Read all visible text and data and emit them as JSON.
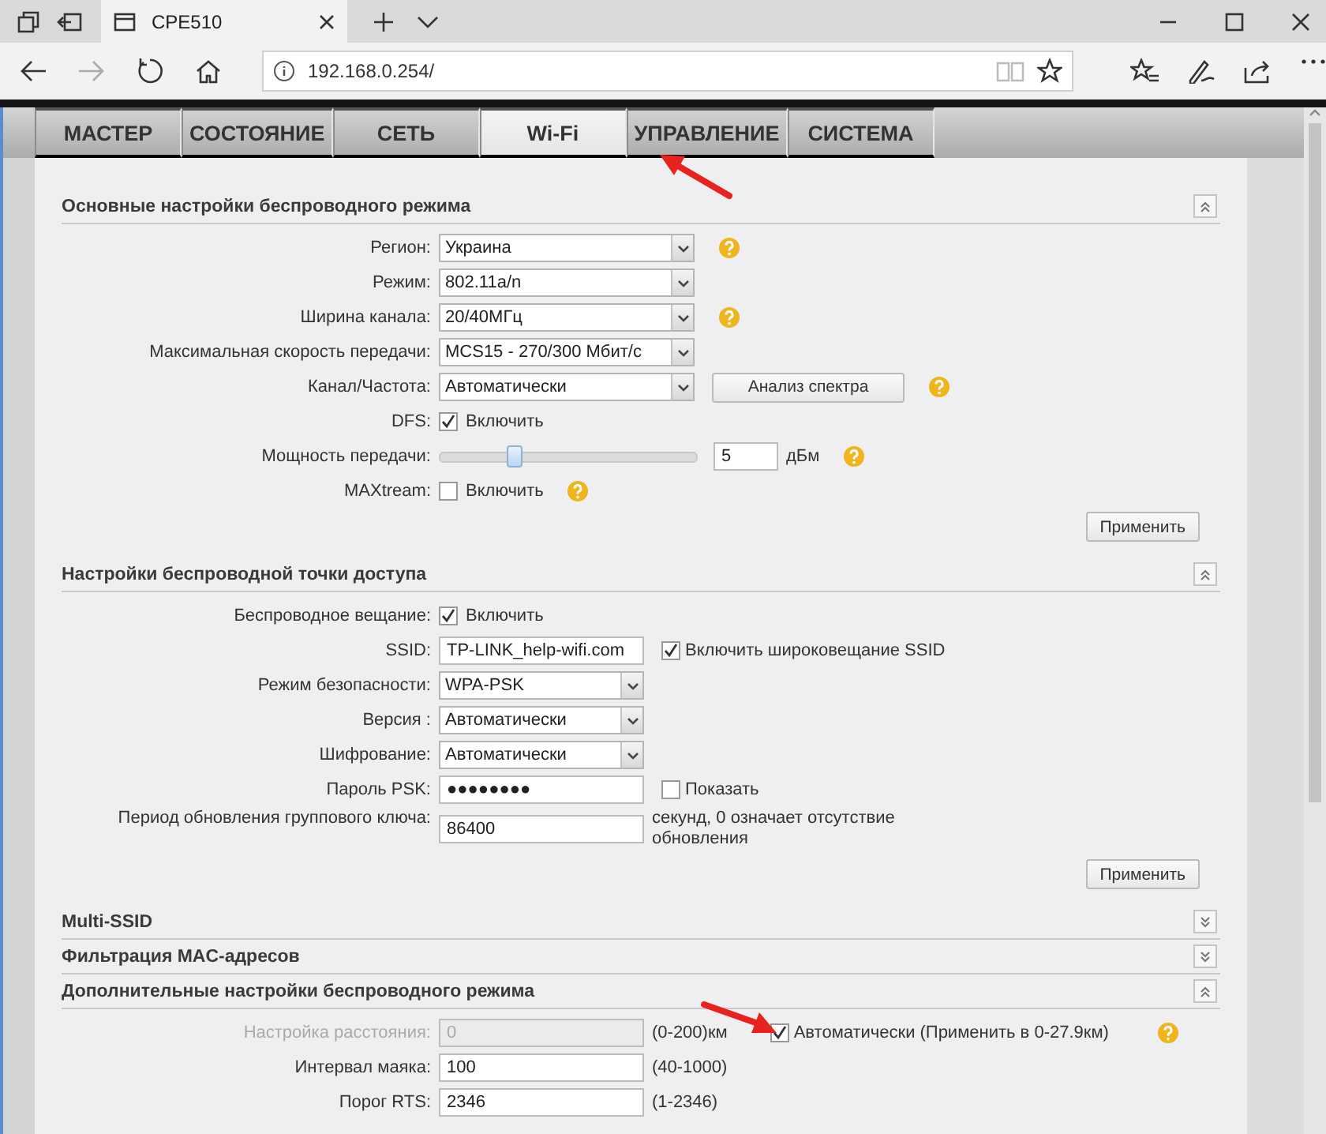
{
  "browser": {
    "tab_title": "CPE510",
    "url": "192.168.0.254/"
  },
  "nav_tabs": [
    {
      "label": "МАСТЕР",
      "selected": false
    },
    {
      "label": "СОСТОЯНИЕ",
      "selected": false
    },
    {
      "label": "СЕТЬ",
      "selected": false
    },
    {
      "label": "Wi-Fi",
      "selected": true
    },
    {
      "label": "УПРАВЛЕНИЕ",
      "selected": false
    },
    {
      "label": "СИСТЕМА",
      "selected": false
    }
  ],
  "sections": [
    {
      "title": "Основные настройки беспроводного режима",
      "expanded": true,
      "rows": [
        {
          "label": "Регион:",
          "kind": "select",
          "value": "Украина",
          "help": true
        },
        {
          "label": "Режим:",
          "kind": "select",
          "value": "802.11a/n",
          "help": false
        },
        {
          "label": "Ширина канала:",
          "kind": "select",
          "value": "20/40МГц",
          "help": true
        },
        {
          "label": "Максимальная скорость передачи:",
          "kind": "select",
          "value": "MCS15 - 270/300 Мбит/с",
          "help": false
        },
        {
          "label": "Канал/Частота:",
          "kind": "select",
          "value": "Автоматически",
          "help": true,
          "button": "Анализ спектра"
        },
        {
          "label": "DFS:",
          "kind": "checkbox",
          "option": "Включить",
          "checked": true,
          "help": false
        },
        {
          "label": "Мощность передачи:",
          "kind": "slider",
          "level": 0.29,
          "value": "5",
          "unit": "дБм",
          "help": true
        },
        {
          "label": "MAXtream:",
          "kind": "checkbox",
          "option": "Включить",
          "checked": false,
          "help": true
        }
      ],
      "apply_button": "Применить"
    },
    {
      "title": "Настройки беспроводной точки доступа",
      "expanded": true,
      "rows": [
        {
          "label": "Беспроводное вещание:",
          "kind": "checkbox",
          "option": "Включить",
          "checked": true,
          "help": false
        },
        {
          "label": "SSID:",
          "kind": "input",
          "value": "TP-LINK_help-wifi.com",
          "checkbox": {
            "label": "Включить широковещание SSID",
            "checked": true
          },
          "help": false
        },
        {
          "label": "Режим безопасности:",
          "kind": "select",
          "value": "WPA-PSK",
          "help": false
        },
        {
          "label": "Версия :",
          "kind": "select",
          "value": "Автоматически",
          "help": false
        },
        {
          "label": "Шифрование:",
          "kind": "select",
          "value": "Автоматически",
          "help": false
        },
        {
          "label": "Пароль PSK:",
          "kind": "input",
          "value": "●●●●●●●●",
          "checkbox": {
            "label": "Показать",
            "checked": false
          },
          "help": false
        },
        {
          "label": "Период обновления группового ключа:",
          "kind": "input",
          "value": "86400",
          "note": "секунд, 0 означает отсутствие обновления",
          "help": false
        }
      ],
      "apply_button": "Применить"
    },
    {
      "title": "Multi-SSID",
      "expanded": false
    },
    {
      "title": "Фильтрация MAC-адресов",
      "expanded": false
    },
    {
      "title": "Дополнительные настройки беспроводного режима",
      "expanded": true,
      "rows": [
        {
          "label": "Настройка расстояния:",
          "kind": "input",
          "value": "0",
          "disabled": true,
          "note": "(0-200)км",
          "checkbox": {
            "label": "Автоматически",
            "checked": true
          },
          "extra": "(Применить в 0-27.9км)",
          "help": true
        },
        {
          "label": "Интервал маяка:",
          "kind": "input",
          "value": "100",
          "disabled": false,
          "note": "(40-1000)",
          "help": false
        },
        {
          "label": "Порог RTS:",
          "kind": "input",
          "value": "2346",
          "disabled": false,
          "note": "(1-2346)",
          "help": false
        }
      ]
    }
  ]
}
